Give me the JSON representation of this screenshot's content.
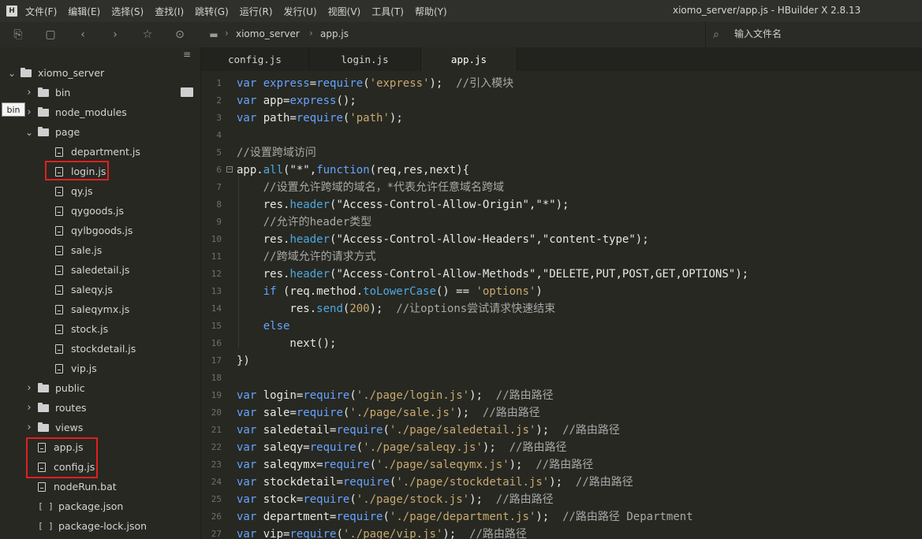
{
  "window": {
    "app_logo": "H",
    "title": "xiomo_server/app.js - HBuilder X 2.8.13"
  },
  "menu": [
    "文件(F)",
    "编辑(E)",
    "选择(S)",
    "查找(I)",
    "跳转(G)",
    "运行(R)",
    "发行(U)",
    "视图(V)",
    "工具(T)",
    "帮助(Y)"
  ],
  "toolbar": {
    "icons": [
      "new-file-icon",
      "save-icon",
      "back-icon",
      "forward-icon",
      "star-icon",
      "run-icon"
    ],
    "breadcrumb": [
      "xiomo_server",
      "app.js"
    ],
    "file_search_placeholder": "输入文件名"
  },
  "sidebar": {
    "tooltip": "bin",
    "tree": [
      {
        "label": "xiomo_server",
        "type": "project",
        "expanded": true
      },
      {
        "label": "bin",
        "type": "folder",
        "expanded": false
      },
      {
        "label": "node_modules",
        "type": "folder",
        "expanded": false
      },
      {
        "label": "page",
        "type": "folder",
        "expanded": true
      },
      {
        "label": "department.js",
        "type": "file"
      },
      {
        "label": "login.js",
        "type": "file",
        "highlighted": true
      },
      {
        "label": "qy.js",
        "type": "file"
      },
      {
        "label": "qygoods.js",
        "type": "file"
      },
      {
        "label": "qylbgoods.js",
        "type": "file"
      },
      {
        "label": "sale.js",
        "type": "file"
      },
      {
        "label": "saledetail.js",
        "type": "file"
      },
      {
        "label": "saleqy.js",
        "type": "file"
      },
      {
        "label": "saleqymx.js",
        "type": "file"
      },
      {
        "label": "stock.js",
        "type": "file"
      },
      {
        "label": "stockdetail.js",
        "type": "file"
      },
      {
        "label": "vip.js",
        "type": "file"
      },
      {
        "label": "public",
        "type": "folder",
        "expanded": false
      },
      {
        "label": "routes",
        "type": "folder",
        "expanded": false
      },
      {
        "label": "views",
        "type": "folder",
        "expanded": false
      },
      {
        "label": "app.js",
        "type": "file",
        "highlighted": true
      },
      {
        "label": "config.js",
        "type": "file",
        "highlighted": true
      },
      {
        "label": "nodeRun.bat",
        "type": "file"
      },
      {
        "label": "package.json",
        "type": "json"
      },
      {
        "label": "package-lock.json",
        "type": "json"
      }
    ]
  },
  "tabs": [
    {
      "label": "config.js",
      "active": false
    },
    {
      "label": "login.js",
      "active": false
    },
    {
      "label": "app.js",
      "active": true
    }
  ],
  "editor": {
    "lines": [
      "var express=require('express');  //引入模块",
      "var app=express();",
      "var path=require('path');",
      "",
      "//设置跨域访问",
      "app.all(\"*\",function(req,res,next){",
      "    //设置允许跨域的域名，*代表允许任意域名跨域",
      "    res.header(\"Access-Control-Allow-Origin\",\"*\");",
      "    //允许的header类型",
      "    res.header(\"Access-Control-Allow-Headers\",\"content-type\");",
      "    //跨域允许的请求方式",
      "    res.header(\"Access-Control-Allow-Methods\",\"DELETE,PUT,POST,GET,OPTIONS\");",
      "    if (req.method.toLowerCase() == 'options')",
      "        res.send(200);  //让options尝试请求快速结束",
      "    else",
      "        next();",
      "})",
      "",
      "var login=require('./page/login.js');  //路由路径",
      "var sale=require('./page/sale.js');  //路由路径",
      "var saledetail=require('./page/saledetail.js');  //路由路径",
      "var saleqy=require('./page/saleqy.js');  //路由路径",
      "var saleqymx=require('./page/saleqymx.js');  //路由路径",
      "var stockdetail=require('./page/stockdetail.js');  //路由路径",
      "var stock=require('./page/stock.js');  //路由路径",
      "var department=require('./page/department.js');  //路由路径 Department",
      "var vip=require('./page/vip.js');  //路由路径"
    ]
  }
}
